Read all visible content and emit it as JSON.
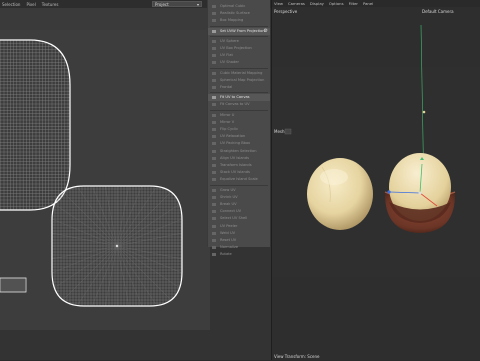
{
  "uv_editor": {
    "menu": [
      "Selection",
      "Pixel",
      "Textures"
    ],
    "project_dropdown": "Project"
  },
  "tool_menu": {
    "items": [
      {
        "label": "Optimal Cubic",
        "active": false,
        "gear": false
      },
      {
        "label": "Realistic Surface",
        "active": false,
        "gear": false
      },
      {
        "label": "Box Mapping",
        "active": false,
        "gear": false
      },
      {
        "label": "Set UVW From Projection",
        "active": true,
        "gear": true
      },
      {
        "label": "UV Sphere",
        "active": false,
        "gear": false
      },
      {
        "label": "UV Box Projection",
        "active": false,
        "gear": false
      },
      {
        "label": "UV Flat",
        "active": false,
        "gear": false
      },
      {
        "label": "UV Shader",
        "active": false,
        "gear": false
      },
      {
        "label": "Cubic Material Mapping",
        "active": false,
        "gear": false
      },
      {
        "label": "Spherical Map Projection",
        "active": false,
        "gear": false
      },
      {
        "label": "Frontal",
        "active": false,
        "gear": false
      },
      {
        "label": "Fit UV to Canvas",
        "active": true,
        "gear": false
      },
      {
        "label": "Fit Canvas to UV",
        "active": false,
        "gear": false
      },
      {
        "label": "Mirror U",
        "active": false,
        "gear": false
      },
      {
        "label": "Mirror V",
        "active": false,
        "gear": false
      },
      {
        "label": "Flip Cyclic",
        "active": false,
        "gear": false
      },
      {
        "label": "UV Relaxation",
        "active": false,
        "gear": false
      },
      {
        "label": "UV Packing Bbox",
        "active": false,
        "gear": false
      },
      {
        "label": "Straighten Selection",
        "active": false,
        "gear": false
      },
      {
        "label": "Align UV Islands",
        "active": false,
        "gear": false
      },
      {
        "label": "Transform Islands",
        "active": false,
        "gear": false
      },
      {
        "label": "Stack UV Islands",
        "active": false,
        "gear": false
      },
      {
        "label": "Equalize Island Scale",
        "active": false,
        "gear": false
      },
      {
        "label": "Grow UV",
        "active": false,
        "gear": false
      },
      {
        "label": "Shrink UV",
        "active": false,
        "gear": false
      },
      {
        "label": "Break UV",
        "active": false,
        "gear": false
      },
      {
        "label": "Connect UV",
        "active": false,
        "gear": false
      },
      {
        "label": "Select UV Shell",
        "active": false,
        "gear": false
      },
      {
        "label": "UV Peeler",
        "active": false,
        "gear": false
      },
      {
        "label": "Weld UV",
        "active": false,
        "gear": false
      },
      {
        "label": "Reset UV",
        "active": false,
        "gear": false
      },
      {
        "label": "Normalize",
        "active": false,
        "gear": false
      },
      {
        "label": "Rotate",
        "active": false,
        "gear": false
      }
    ]
  },
  "viewport": {
    "menu": [
      "View",
      "Cameras",
      "Display",
      "Options",
      "Filter",
      "Panel"
    ],
    "view_name": "Perspective",
    "camera": "Default Camera",
    "mesh_label": "Mesh",
    "footer": "View Transform: Scene"
  },
  "colors": {
    "uv_wire": "#9a9a9a",
    "uv_edge": "#ffffff",
    "nut_light": "#efe2b8",
    "nut_shadow": "#a9905f",
    "shell_brown": "#6b3526",
    "axis_green": "#3fbf6f",
    "axis_blue": "#3b6ee0",
    "axis_red": "#e04a3a"
  }
}
